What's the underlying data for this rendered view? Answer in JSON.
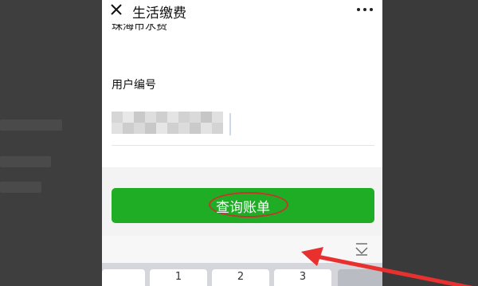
{
  "header": {
    "title": "生活缴费",
    "close_icon": "close-icon",
    "more_icon": "more-icon"
  },
  "form": {
    "previous_value": "珠海市水费",
    "user_number_label": "用户编号",
    "user_number_value_obscured": true
  },
  "query_button": {
    "label": "查询账单",
    "color": "#1fad26"
  },
  "annotation": {
    "circle_color": "#c0392b",
    "arrow_color": "#e8312f"
  },
  "keyboard": {
    "keys": [
      "1",
      "2",
      "3"
    ],
    "collapse_icon": "keyboard-collapse-icon"
  }
}
